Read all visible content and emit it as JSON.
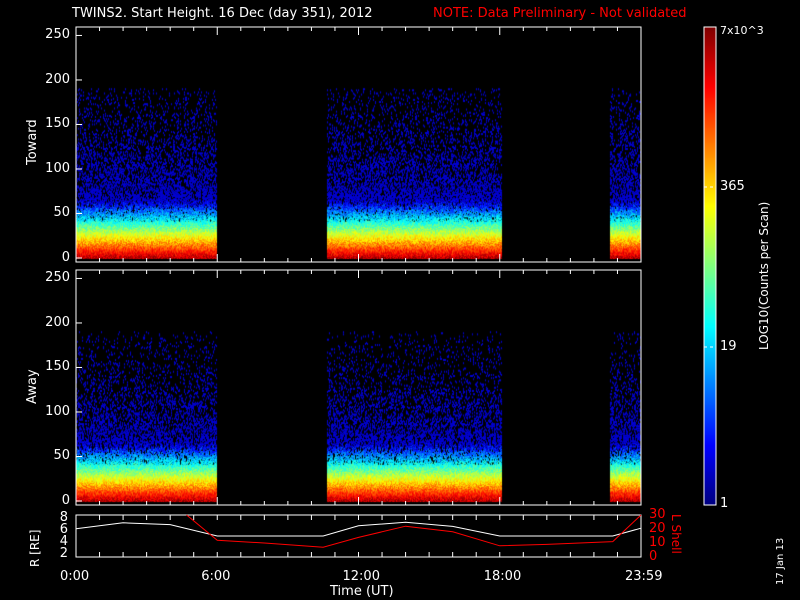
{
  "title": "TWINS2. Start Height. 16 Dec (day 351), 2012",
  "note": "NOTE: Data Preliminary - Not validated",
  "date_stamp": "17 Jan 13",
  "colors": {
    "note": "#ff0000",
    "lshell": "#ff0000",
    "r": "#ffffff",
    "background": "#000000"
  },
  "chart_data": [
    {
      "type": "heatmap",
      "ylabel": "Toward",
      "ylim": [
        0,
        255
      ],
      "yticks": [
        "0",
        "50",
        "100",
        "150",
        "200",
        "250"
      ],
      "xlim_hours": [
        0,
        24
      ],
      "data_intervals_ut": [
        [
          "0:00",
          "6:00"
        ],
        [
          "10:40",
          "18:05"
        ],
        [
          "22:40",
          "23:59"
        ]
      ]
    },
    {
      "type": "heatmap",
      "ylabel": "Away",
      "ylim": [
        0,
        255
      ],
      "yticks": [
        "0",
        "50",
        "100",
        "150",
        "200",
        "250"
      ],
      "xlim_hours": [
        0,
        24
      ],
      "data_intervals_ut": [
        [
          "0:00",
          "6:00"
        ],
        [
          "10:40",
          "18:05"
        ],
        [
          "22:40",
          "23:59"
        ]
      ]
    },
    {
      "type": "line",
      "xlabel": "Time (UT)",
      "xticks": [
        "0:00",
        "6:00",
        "12:00",
        "18:00",
        "23:59"
      ],
      "ylabel": "R [RE]",
      "yticks": [
        "2",
        "4",
        "6",
        "8"
      ],
      "ylim": [
        1.5,
        8.5
      ],
      "y2label": "L Shell",
      "y2ticks": [
        "0",
        "10",
        "20",
        "30"
      ],
      "y2lim": [
        0,
        30
      ],
      "series": [
        {
          "name": "R [RE]",
          "x": [
            0,
            2,
            4,
            6,
            8,
            10.5,
            12,
            14,
            16,
            18,
            20,
            22.8,
            24
          ],
          "y": [
            6.2,
            7.2,
            6.9,
            5.0,
            5.0,
            5.0,
            6.7,
            7.3,
            6.6,
            5.0,
            5.0,
            5.0,
            6.3
          ]
        },
        {
          "name": "L Shell",
          "x": [
            4.7,
            6,
            8,
            10.5,
            12,
            14,
            16,
            18,
            20,
            22.8,
            24
          ],
          "y": [
            30,
            12,
            10,
            7,
            14,
            22,
            18,
            8,
            9,
            11,
            30
          ]
        }
      ]
    }
  ],
  "colorbar": {
    "label": "LOG10(Counts per Scan)",
    "ticks": [
      "1",
      "19",
      "365",
      "7x10^3"
    ]
  }
}
